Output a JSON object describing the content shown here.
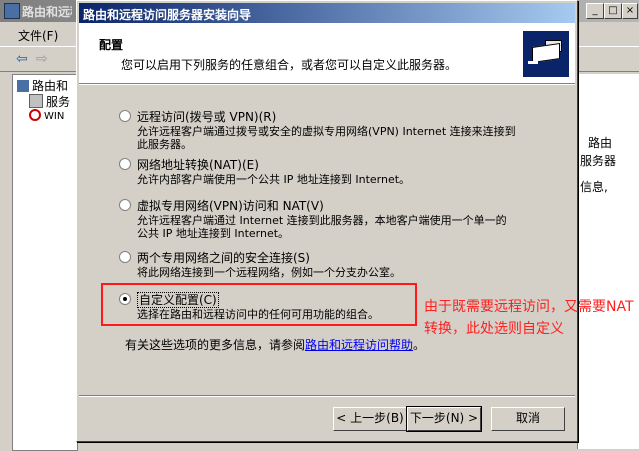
{
  "background_window": {
    "title": "路由和远程访问",
    "menu_item": "文件(F)",
    "tree_items": [
      "路由和",
      "服务",
      "WIN"
    ],
    "right_fragments": [
      "路由",
      "服务器",
      "信息,"
    ]
  },
  "wizard": {
    "title": "路由和远程访问服务器安装向导",
    "header_title": "配置",
    "header_subtitle": "您可以启用下列服务的任意组合，或者您可以自定义此服务器。",
    "options": [
      {
        "label": "远程访问(拨号或 VPN)(R)",
        "desc": "允许远程客户端通过拨号或安全的虚拟专用网络(VPN) Internet 连接来连接到\n此服务器。",
        "checked": false
      },
      {
        "label": "网络地址转换(NAT)(E)",
        "desc": "允许内部客户端使用一个公共 IP 地址连接到 Internet。",
        "checked": false
      },
      {
        "label": "虚拟专用网络(VPN)访问和 NAT(V)",
        "desc": "允许远程客户端通过 Internet 连接到此服务器，本地客户端使用一个单一的\n公共 IP 地址连接到 Internet。",
        "checked": false
      },
      {
        "label": "两个专用网络之间的安全连接(S)",
        "desc": "将此网络连接到一个远程网络，例如一个分支办公室。",
        "checked": false
      },
      {
        "label": "自定义配置(C)",
        "desc": "选择在路由和远程访问中的任何可用功能的组合。",
        "checked": true
      }
    ],
    "more_info_prefix": "有关这些选项的更多信息，请参阅",
    "more_info_link": "路由和远程访问帮助",
    "more_info_suffix": "。",
    "buttons": {
      "back": "< 上一步(B)",
      "next": "下一步(N) >",
      "cancel": "取消"
    }
  },
  "annotation": {
    "text": "由于既需要远程访问，又需要NAT转换，此处选则自定义",
    "color": "#ff2020"
  }
}
